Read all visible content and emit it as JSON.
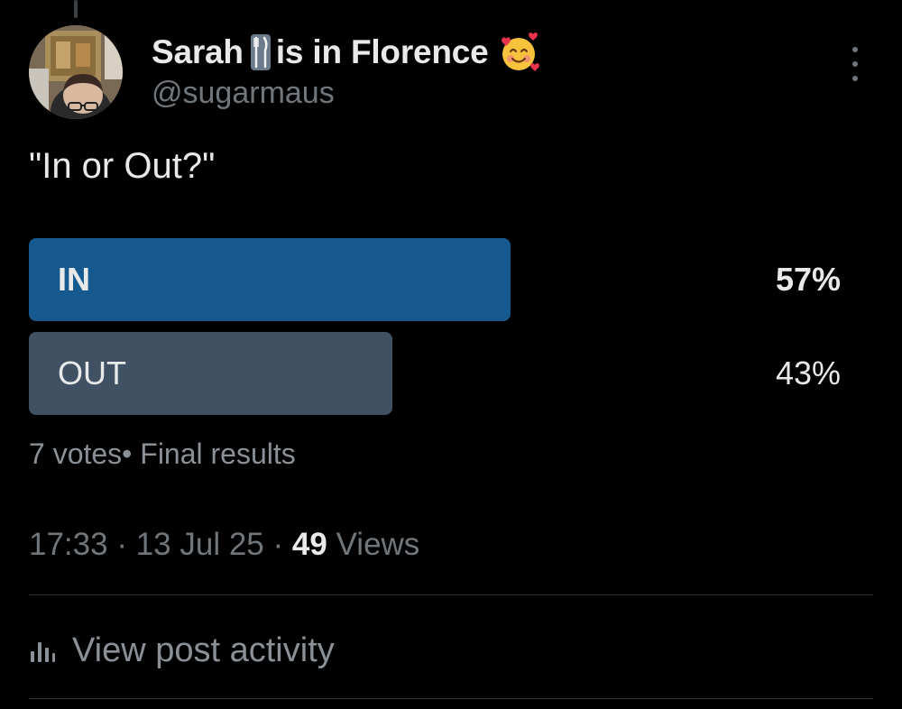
{
  "post": {
    "author": {
      "name_part1": "Sarah",
      "name_part2": "is in Florence",
      "handle": "@sugarmaus",
      "name_icons": [
        "fork-knife-icon",
        "smiling-face-with-hearts-icon"
      ]
    },
    "text": "\"In or Out?\"",
    "poll": {
      "options": [
        {
          "label": "IN",
          "percent_label": "57%",
          "percent": 57,
          "leading": true
        },
        {
          "label": "OUT",
          "percent_label": "43%",
          "percent": 43,
          "leading": false
        }
      ],
      "summary": "7 votes• Final results"
    },
    "meta": {
      "time": "17:33",
      "date": "13 Jul 25",
      "views_count": "49",
      "views_label": "Views"
    },
    "activity_label": "View post activity"
  },
  "colors": {
    "background": "#000000",
    "leading_bar": "#15598e",
    "trailing_bar": "#3f5162",
    "secondary_text": "#71767b",
    "divider": "#2f3336"
  }
}
